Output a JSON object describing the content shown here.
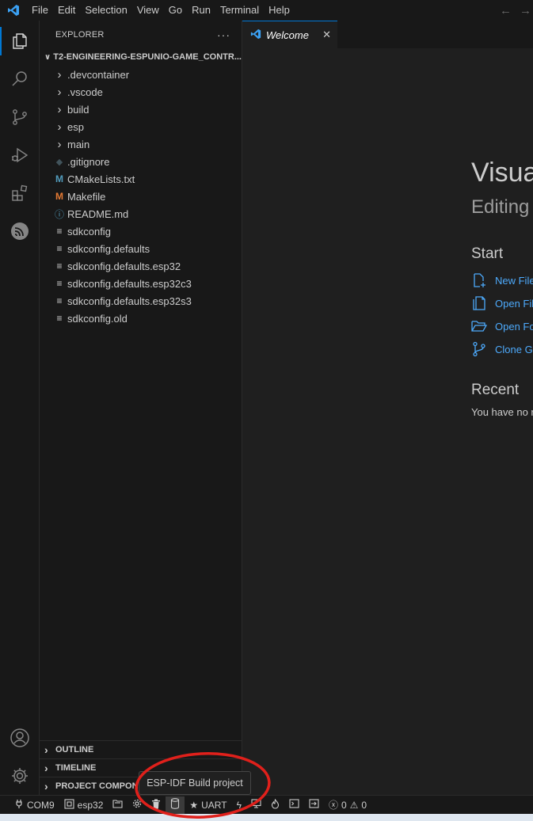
{
  "menu": [
    "File",
    "Edit",
    "Selection",
    "View",
    "Go",
    "Run",
    "Terminal",
    "Help"
  ],
  "explorer": {
    "header": "EXPLORER",
    "more": "···",
    "root_folder": "T2-ENGINEERING-ESPUNIO-GAME_CONTR...",
    "items": [
      {
        "label": ".devcontainer",
        "type": "folder"
      },
      {
        "label": ".vscode",
        "type": "folder"
      },
      {
        "label": "build",
        "type": "folder"
      },
      {
        "label": "esp",
        "type": "folder"
      },
      {
        "label": "main",
        "type": "folder"
      },
      {
        "label": ".gitignore",
        "type": "git"
      },
      {
        "label": "CMakeLists.txt",
        "type": "cmake"
      },
      {
        "label": "Makefile",
        "type": "make"
      },
      {
        "label": "README.md",
        "type": "info"
      },
      {
        "label": "sdkconfig",
        "type": "lines"
      },
      {
        "label": "sdkconfig.defaults",
        "type": "lines"
      },
      {
        "label": "sdkconfig.defaults.esp32",
        "type": "lines"
      },
      {
        "label": "sdkconfig.defaults.esp32c3",
        "type": "lines"
      },
      {
        "label": "sdkconfig.defaults.esp32s3",
        "type": "lines"
      },
      {
        "label": "sdkconfig.old",
        "type": "lines"
      }
    ],
    "glyphs": {
      "cmake": "M",
      "make": "M",
      "info": "ⓘ",
      "git": "◆",
      "lines": "≡"
    },
    "sections": [
      "OUTLINE",
      "TIMELINE",
      "PROJECT COMPONE"
    ]
  },
  "tab": {
    "label": "Welcome",
    "close": "✕"
  },
  "welcome": {
    "title": "Visua",
    "subtitle": "Editing",
    "start_heading": "Start",
    "links": [
      {
        "label": "New File",
        "icon": "new-file-icon"
      },
      {
        "label": "Open Fil",
        "icon": "open-file-icon"
      },
      {
        "label": "Open Fo",
        "icon": "open-folder-icon"
      },
      {
        "label": "Clone Gi",
        "icon": "source-control-icon"
      }
    ],
    "recent_heading": "Recent",
    "recent_text": "You have no r"
  },
  "statusbar": {
    "port": "COM9",
    "target": "esp32",
    "flash_mode": "UART",
    "errors": "0",
    "warnings": "0"
  },
  "tooltip": "ESP-IDF Build project",
  "colors": {
    "accent": "#0078d4",
    "link": "#4daafc",
    "annotation": "#e0201b"
  }
}
